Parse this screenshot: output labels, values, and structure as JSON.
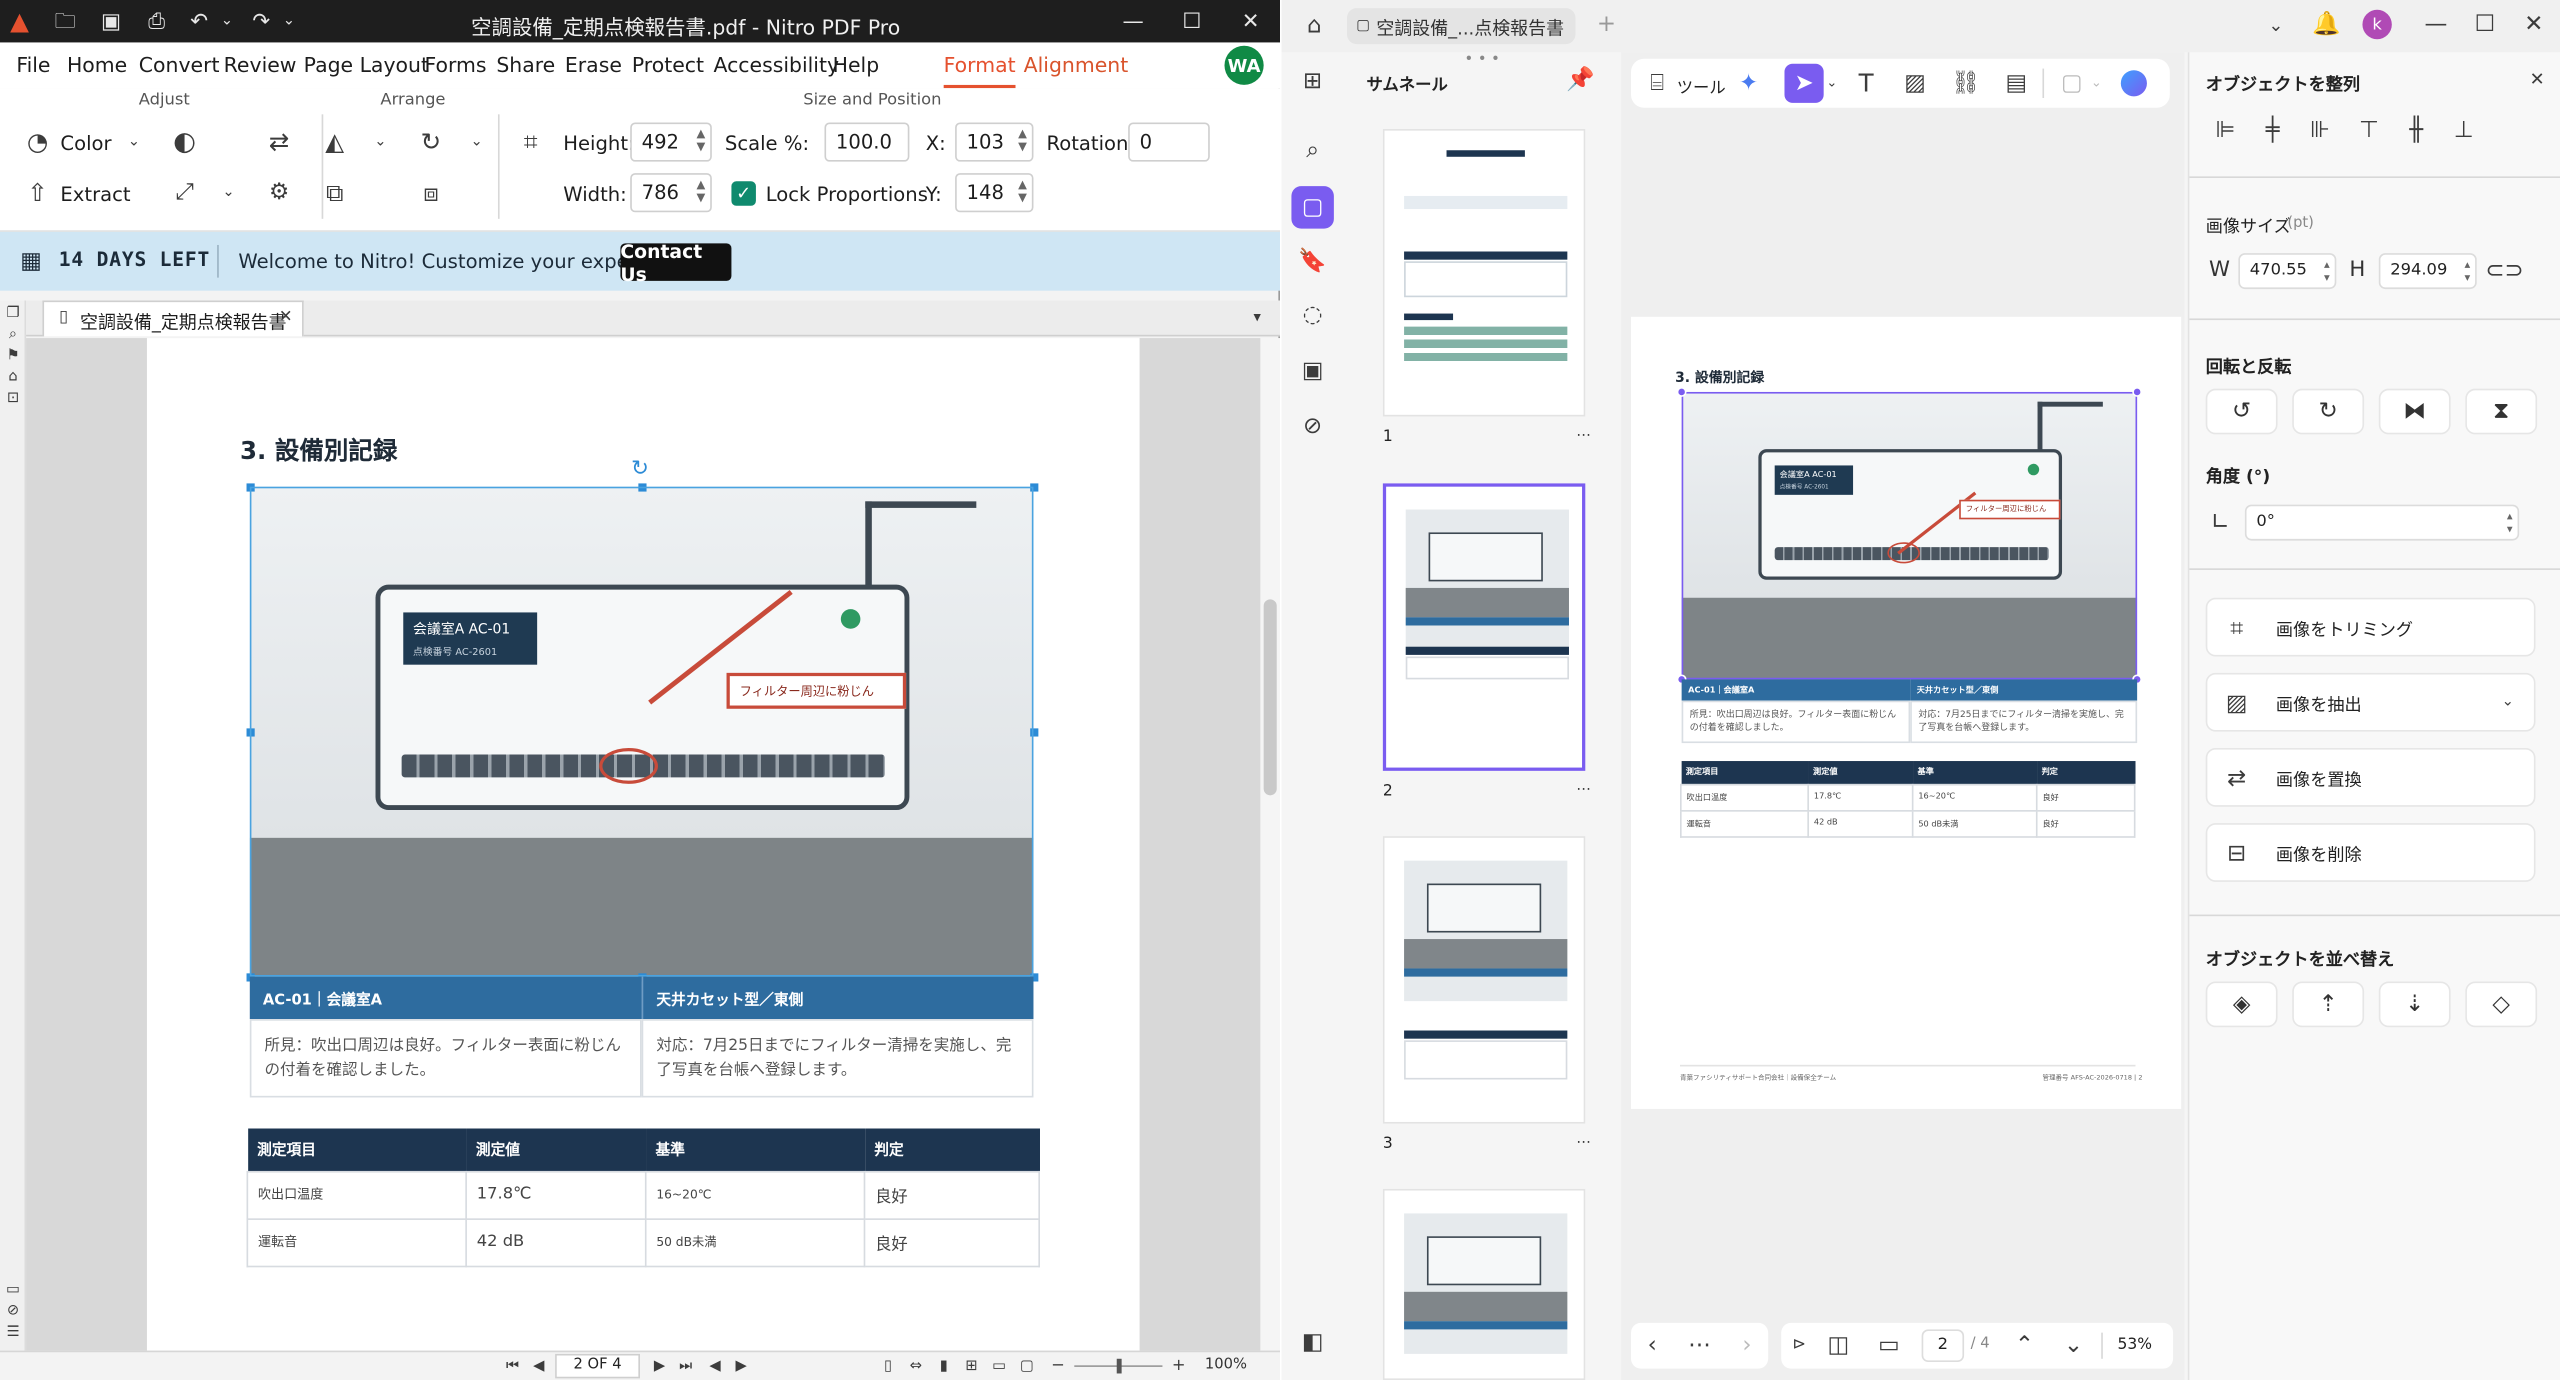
{
  "nitro": {
    "title": "空調設備_定期点検報告書.pdf - Nitro PDF Pro",
    "menu": [
      "File",
      "Home",
      "Convert",
      "Review",
      "Page Layout",
      "Forms",
      "Share",
      "Erase",
      "Protect",
      "Accessibility",
      "Help",
      "Format",
      "Alignment"
    ],
    "active_menu": "Format",
    "avatar": "WA",
    "ribbon": {
      "groups": {
        "adjust": "Adjust",
        "arrange": "Arrange",
        "size_position": "Size and Position"
      },
      "color_label": "Color",
      "extract_label": "Extract",
      "height_label": "Height:",
      "height_value": "492",
      "width_label": "Width:",
      "width_value": "786",
      "scale_label": "Scale %:",
      "scale_value": "100.0",
      "x_label": "X:",
      "x_value": "103",
      "y_label": "Y:",
      "y_value": "148",
      "rotation_label": "Rotation:",
      "rotation_value": "0",
      "lock_label": "Lock Proportions"
    },
    "banner": {
      "days_left": "14 DAYS LEFT",
      "welcome": "Welcome to Nitro! Customize your experience.",
      "contact": "Contact Us"
    },
    "doc_tab": "空調設備_定期点検報告書",
    "status": {
      "page": "2 OF 4",
      "zoom": "100%"
    }
  },
  "doc": {
    "section_title": "3.  設備別記録",
    "plate_title": "会議室A AC-01",
    "plate_sub": "点検番号 AC-2601",
    "callout": "フィルター周辺に粉じん",
    "caption_left_head": "AC-01｜会議室A",
    "caption_right_head": "天井カセット型／東側",
    "caption_left_body": "所見：吹出口周辺は良好。フィルター表面に粉じんの付着を確認しました。",
    "caption_right_body": "対応：7月25日までにフィルター清掃を実施し、完了写真を台帳へ登録します。",
    "table_headers": [
      "測定項目",
      "測定値",
      "基準",
      "判定"
    ],
    "table_rows": [
      [
        "吹出口温度",
        "17.8℃",
        "16~20℃",
        "良好"
      ],
      [
        "運転音",
        "42 dB",
        "50 dB未満",
        "良好"
      ]
    ],
    "footer_left": "青葉ファシリティサポート合同会社｜設備保全チーム",
    "footer_right": "管理番号 AFS-AC-2026-0718 | 2"
  },
  "pdfelement": {
    "tab_title": "空調設備_...点検報告書",
    "avatar": "k",
    "thumbs_title": "サムネール",
    "thumb_labels": [
      "1",
      "2",
      "3"
    ],
    "tools_label": "ツール",
    "page_current": "2",
    "page_total": "/ 4",
    "zoom": "53%",
    "props": {
      "align_head": "オブジェクトを整列",
      "size_head": "画像サイズ",
      "size_unit": "(pt)",
      "w_label": "W",
      "w_value": "470.55",
      "h_label": "H",
      "h_value": "294.09",
      "rotate_head": "回転と反転",
      "angle_head": "角度 (°)",
      "angle_value": "0°",
      "crop": "画像をトリミング",
      "extract": "画像を抽出",
      "replace": "画像を置換",
      "delete": "画像を削除",
      "order_head": "オブジェクトを並べ替え"
    }
  }
}
